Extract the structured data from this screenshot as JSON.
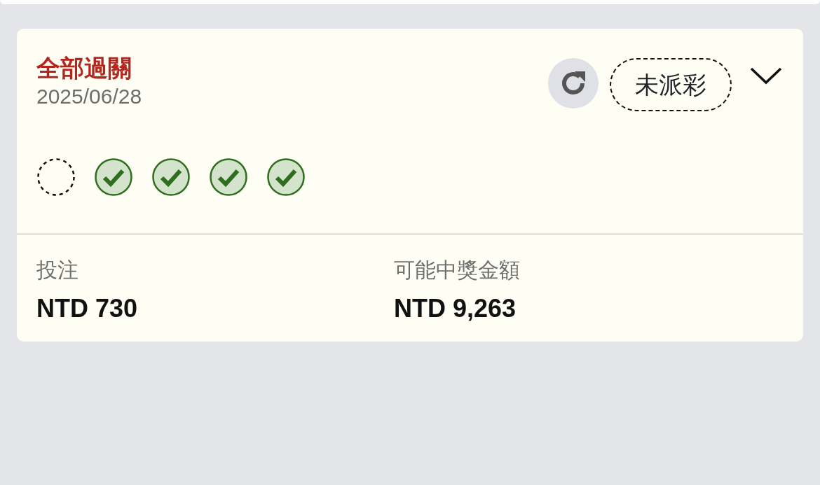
{
  "bet": {
    "type": "全部過關",
    "date": "2025/06/28",
    "status": "未派彩",
    "expanded": false,
    "legs": [
      {
        "kind": "pending"
      },
      {
        "kind": "won"
      },
      {
        "kind": "won"
      },
      {
        "kind": "won"
      },
      {
        "kind": "won"
      }
    ],
    "stake": {
      "label": "投注",
      "value": "NTD 730"
    },
    "payout": {
      "label": "可能中獎金額",
      "value": "NTD 9,263"
    }
  }
}
